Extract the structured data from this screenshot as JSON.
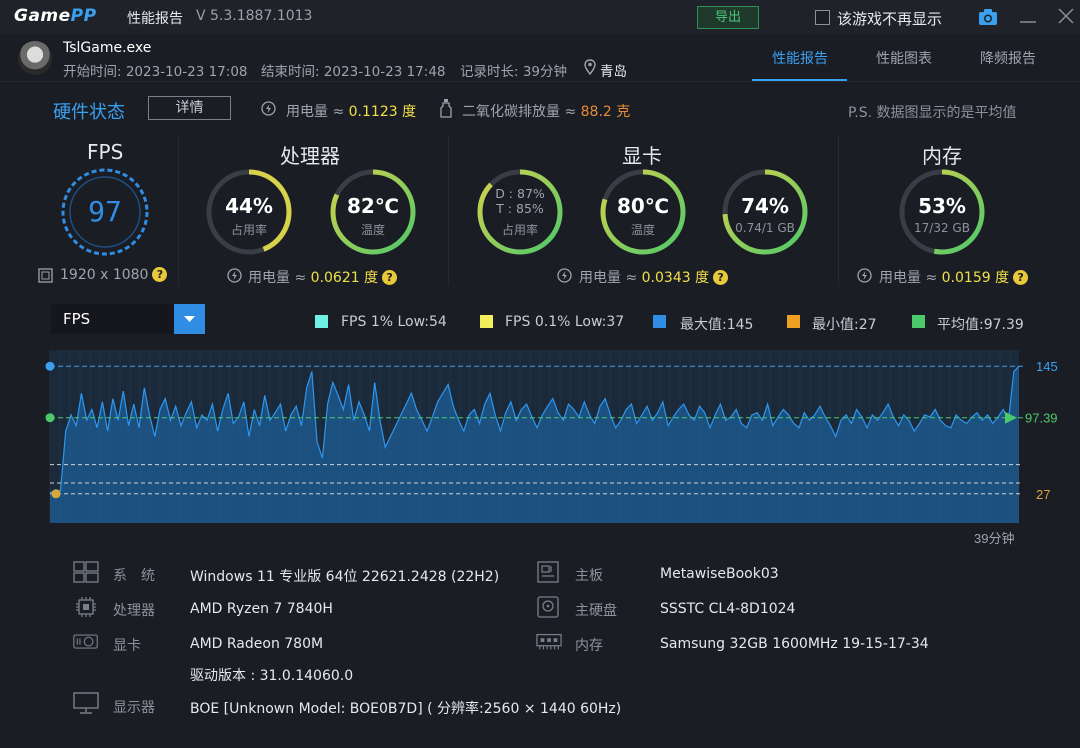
{
  "titlebar": {
    "logo_main": "Game",
    "logo_accent": "PP",
    "title": "性能报告",
    "version": "V 5.3.1887.1013",
    "export_label": "导出",
    "no_show_label": "该游戏不再显示"
  },
  "session": {
    "exe": "TslGame.exe",
    "start": "开始时间: 2023-10-23 17:08",
    "end": "结束时间: 2023-10-23 17:48",
    "duration": "记录时长: 39分钟",
    "location": "青岛"
  },
  "tabs": [
    {
      "label": "性能报告",
      "active": true
    },
    {
      "label": "性能图表",
      "active": false
    },
    {
      "label": "降频报告",
      "active": false
    }
  ],
  "hw": {
    "title": "硬件状态",
    "details_label": "详情",
    "power_prefix": "用电量 ≈ ",
    "power_value": "0.1123 度",
    "co2_prefix": "二氧化碳排放量 ≈ ",
    "co2_value": "88.2 克",
    "note": "P.S. 数据图显示的是平均值"
  },
  "sections": {
    "fps": {
      "title": "FPS",
      "value": "97",
      "resolution": "1920 x 1080"
    },
    "cpu": {
      "title": "处理器",
      "usage_value": "44%",
      "usage_label": "占用率",
      "usage_fraction": 0.44,
      "temp_value": "82℃",
      "temp_label": "温度",
      "temp_fraction": 0.82,
      "power_prefix": "用电量 ≈ ",
      "power_value": "0.0621 度"
    },
    "gpu": {
      "title": "显卡",
      "d_line": "D : 87%",
      "t_line": "T : 85%",
      "usage_label": "占用率",
      "usage_fraction": 0.87,
      "temp_value": "80℃",
      "temp_label": "温度",
      "temp_fraction": 0.8,
      "mem_value": "74%",
      "mem_label": "0.74/1 GB",
      "mem_fraction": 0.74,
      "power_prefix": "用电量 ≈ ",
      "power_value": "0.0343 度"
    },
    "ram": {
      "title": "内存",
      "value": "53%",
      "label": "17/32 GB",
      "fraction": 0.53,
      "power_prefix": "用电量 ≈ ",
      "power_value": "0.0159 度"
    }
  },
  "colors": {
    "accent": "#3aa0f0",
    "gauge_green": "#4cc96a",
    "gauge_yellow": "#d8d24a",
    "gauge_track": "#3a3d45",
    "legend_cyan": "#6ff0e4",
    "legend_yellow": "#f2ef5a",
    "legend_blue": "#2f8de4",
    "legend_orange": "#f0a020",
    "legend_green": "#4cc96a"
  },
  "chart_controls": {
    "metric": "FPS"
  },
  "legend": [
    {
      "label": "FPS 1% Low:54",
      "color": "#6ff0e4"
    },
    {
      "label": "FPS 0.1% Low:37",
      "color": "#f2ef5a"
    },
    {
      "label": "最大值:145",
      "color": "#2f8de4"
    },
    {
      "label": "最小值:27",
      "color": "#f0a020"
    },
    {
      "label": "平均值:97.39",
      "color": "#4cc96a"
    }
  ],
  "chart_data": {
    "type": "area",
    "title": "",
    "xlabel": "",
    "ylabel": "",
    "x_end_label": "39分钟",
    "ylim": [
      0,
      160
    ],
    "ref_lines": {
      "max": 145,
      "avg": 97.39,
      "min": 27,
      "low1": 54,
      "low01": 37
    },
    "ref_labels": {
      "max": "145",
      "avg": "97.39",
      "min": "27"
    },
    "series": [
      {
        "values": [
          28,
          30,
          30,
          85,
          100,
          90,
          120,
          95,
          105,
          88,
          112,
          85,
          115,
          95,
          122,
          90,
          110,
          88,
          125,
          100,
          80,
          105,
          115,
          95,
          108,
          90,
          102,
          112,
          88,
          100,
          95,
          110,
          85,
          105,
          120,
          92,
          98,
          112,
          80,
          105,
          90,
          118,
          95,
          102,
          110,
          85,
          100,
          108,
          90,
          125,
          140,
          75,
          60,
          110,
          130,
          118,
          105,
          128,
          95,
          112,
          100,
          85,
          130,
          95,
          70,
          80,
          90,
          100,
          110,
          120,
          105,
          95,
          85,
          98,
          112,
          120,
          128,
          108,
          95,
          85,
          100,
          105,
          92,
          110,
          120,
          100,
          85,
          102,
          112,
          95,
          105,
          110,
          98,
          88,
          100,
          108,
          115,
          102,
          95,
          110,
          105,
          98,
          112,
          100,
          92,
          108,
          115,
          100,
          88,
          95,
          105,
          110,
          92,
          100,
          108,
          95,
          102,
          112,
          90,
          98,
          105,
          110,
          100,
          95,
          108,
          102,
          88,
          100,
          110,
          95,
          98,
          105,
          92,
          88,
          100,
          102,
          95,
          110,
          90,
          98,
          105,
          100,
          92,
          88,
          102,
          95,
          100,
          108,
          98,
          90,
          80,
          95,
          100,
          92,
          105,
          98,
          88,
          100,
          95,
          102,
          110,
          98,
          90,
          100,
          95,
          85,
          92,
          100,
          98,
          105,
          95,
          90,
          88,
          100,
          95,
          92,
          98,
          102,
          95,
          100,
          92,
          98,
          105,
          95,
          140,
          145
        ]
      }
    ]
  },
  "system": [
    {
      "label": "系　统",
      "value": "Windows 11 专业版 64位 22621.2428 (22H2)",
      "icon": "windows-icon"
    },
    {
      "label": "处理器",
      "value": "AMD Ryzen 7 7840H",
      "icon": "cpu-icon"
    },
    {
      "label": "显卡",
      "value": "AMD Radeon 780M",
      "icon": "gpu-icon"
    },
    {
      "label": "",
      "value": "驱动版本 : 31.0.14060.0",
      "icon": ""
    },
    {
      "label": "显示器",
      "value": "BOE [Unknown Model: BOE0B7D] ( 分辨率:2560 × 1440 60Hz)",
      "icon": "monitor-icon"
    },
    {
      "label": "主板",
      "value": "MetawiseBook03",
      "icon": "motherboard-icon"
    },
    {
      "label": "主硬盘",
      "value": "SSSTC CL4-8D1024",
      "icon": "disk-icon"
    },
    {
      "label": "内存",
      "value": "Samsung 32GB 1600MHz 19-15-17-34",
      "icon": "memory-icon"
    }
  ]
}
